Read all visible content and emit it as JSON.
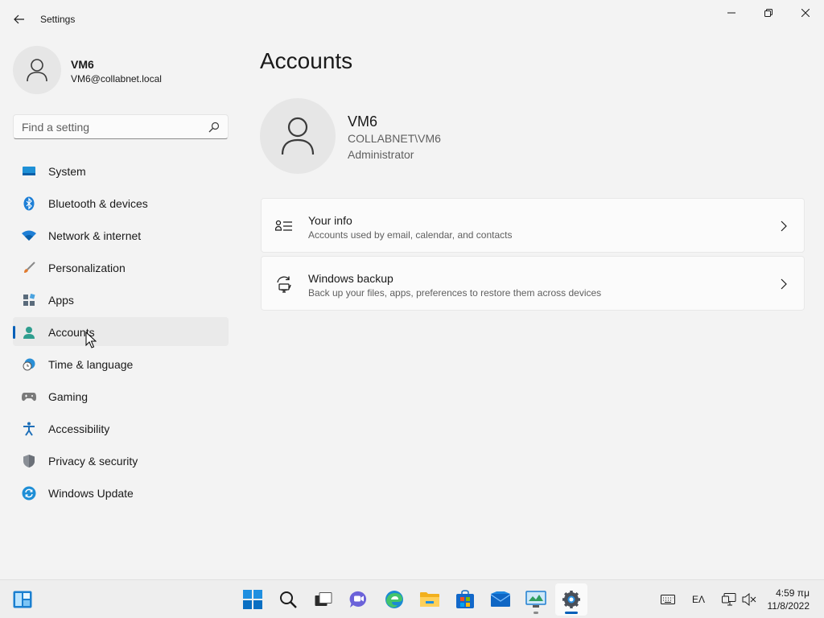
{
  "window": {
    "title": "Settings"
  },
  "profile": {
    "name": "VM6",
    "email": "VM6@collabnet.local"
  },
  "search": {
    "placeholder": "Find a setting"
  },
  "nav": {
    "items": [
      {
        "label": "System",
        "icon": "system-icon"
      },
      {
        "label": "Bluetooth & devices",
        "icon": "bluetooth-icon"
      },
      {
        "label": "Network & internet",
        "icon": "wifi-icon"
      },
      {
        "label": "Personalization",
        "icon": "brush-icon"
      },
      {
        "label": "Apps",
        "icon": "apps-icon"
      },
      {
        "label": "Accounts",
        "icon": "person-icon",
        "active": true
      },
      {
        "label": "Time & language",
        "icon": "clock-globe-icon"
      },
      {
        "label": "Gaming",
        "icon": "gamepad-icon"
      },
      {
        "label": "Accessibility",
        "icon": "accessibility-icon"
      },
      {
        "label": "Privacy & security",
        "icon": "shield-icon"
      },
      {
        "label": "Windows Update",
        "icon": "update-icon"
      }
    ]
  },
  "main": {
    "title": "Accounts",
    "account": {
      "name": "VM6",
      "domain": "COLLABNET\\VM6",
      "role": "Administrator"
    },
    "cards": [
      {
        "title": "Your info",
        "subtitle": "Accounts used by email, calendar, and contacts",
        "icon": "person-list-icon"
      },
      {
        "title": "Windows backup",
        "subtitle": "Back up your files, apps, preferences to restore them across devices",
        "icon": "backup-icon"
      }
    ]
  },
  "taskbar": {
    "apps": [
      "start",
      "search",
      "task-view",
      "chat",
      "edge",
      "file-explorer",
      "store",
      "mail",
      "remote-desktop",
      "settings"
    ],
    "tray": {
      "language": "ΕΛ",
      "time": "4:59 πμ",
      "date": "11/8/2022"
    }
  },
  "colors": {
    "accent": "#005fb8",
    "background": "#f3f3f3",
    "card": "#fbfbfb"
  }
}
